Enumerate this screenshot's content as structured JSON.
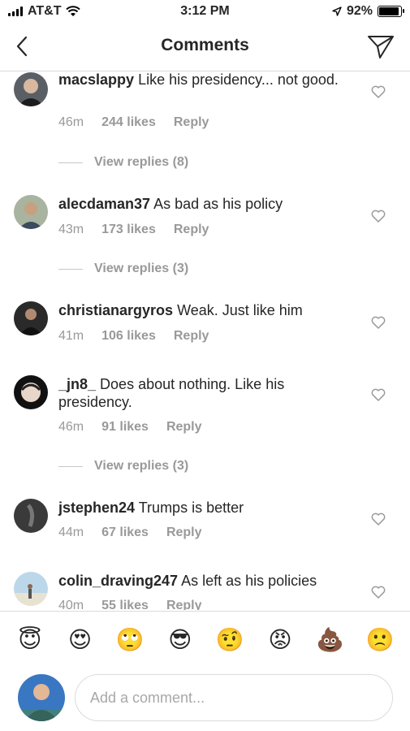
{
  "status_bar": {
    "carrier": "AT&T",
    "time": "3:12 PM",
    "battery": "92%",
    "battery_level": 0.92
  },
  "header": {
    "title": "Comments"
  },
  "comments": [
    {
      "username": "macslappy",
      "text": "Like his presidency... not good.",
      "time": "46m",
      "likes": "244 likes",
      "reply": "Reply",
      "view_replies": "View replies (8)"
    },
    {
      "username": "alecdaman37",
      "text": "As bad as his policy",
      "time": "43m",
      "likes": "173 likes",
      "reply": "Reply",
      "view_replies": "View replies (3)"
    },
    {
      "username": "christianargyros",
      "text": "Weak. Just like him",
      "time": "41m",
      "likes": "106 likes",
      "reply": "Reply"
    },
    {
      "username": "_jn8_",
      "text": "Does about nothing. Like his presidency.",
      "time": "46m",
      "likes": "91 likes",
      "reply": "Reply",
      "view_replies": "View replies (3)"
    },
    {
      "username": "jstephen24",
      "text": "Trumps is better",
      "time": "44m",
      "likes": "67 likes",
      "reply": "Reply"
    },
    {
      "username": "colin_draving247",
      "text": "As left as his policies",
      "time": "40m",
      "likes": "55 likes",
      "reply": "Reply"
    }
  ],
  "emoji_bar": [
    "😇",
    "😍",
    "🙄",
    "😎",
    "🤨",
    "😡",
    "💩",
    "🙁"
  ],
  "compose": {
    "placeholder": "Add a comment..."
  }
}
